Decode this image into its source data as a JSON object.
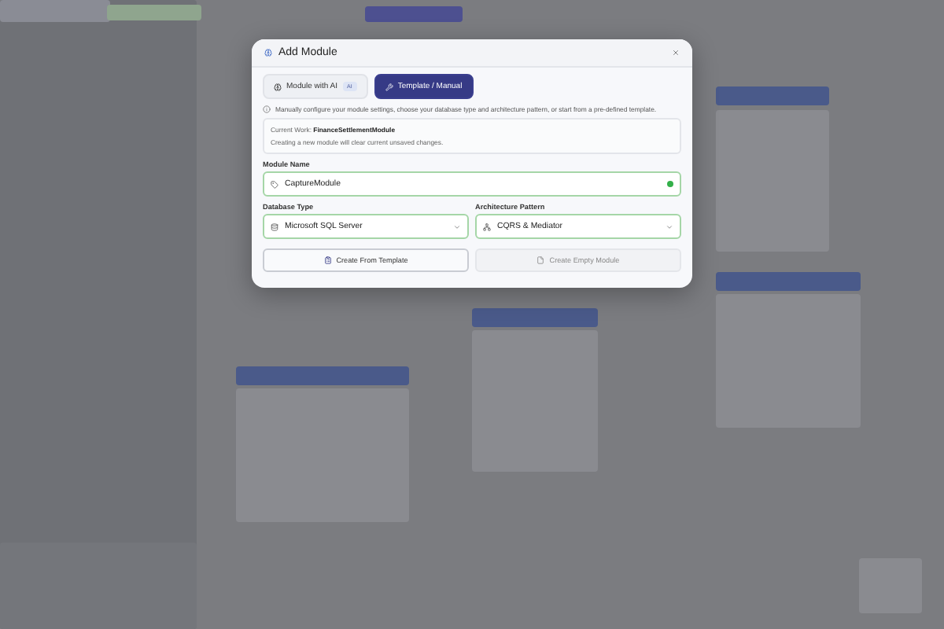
{
  "dialog": {
    "title": "Add Module",
    "tabs": [
      {
        "label": "Module with AI",
        "badge": "AI",
        "selected": false
      },
      {
        "label": "Template / Manual",
        "selected": true
      }
    ],
    "info": "Manually configure your module settings, choose your database type and architecture pattern, or start from a pre-defined template.",
    "current_work": {
      "label": "Current Work:",
      "value": "FinanceSettlementModule",
      "note": "Creating a new module will clear current unsaved changes."
    },
    "module_name": {
      "label": "Module Name",
      "value": "CaptureModule",
      "valid": true
    },
    "selects": [
      {
        "kind": "database",
        "label": "Database Type",
        "value": "Microsoft SQL Server"
      },
      {
        "kind": "architecture",
        "label": "Architecture Pattern",
        "value": "CQRS & Mediator"
      }
    ],
    "buttons": [
      {
        "kind": "template",
        "label": "Create From Template",
        "disabled": false
      },
      {
        "kind": "empty",
        "label": "Create Empty Module",
        "disabled": true
      }
    ]
  }
}
